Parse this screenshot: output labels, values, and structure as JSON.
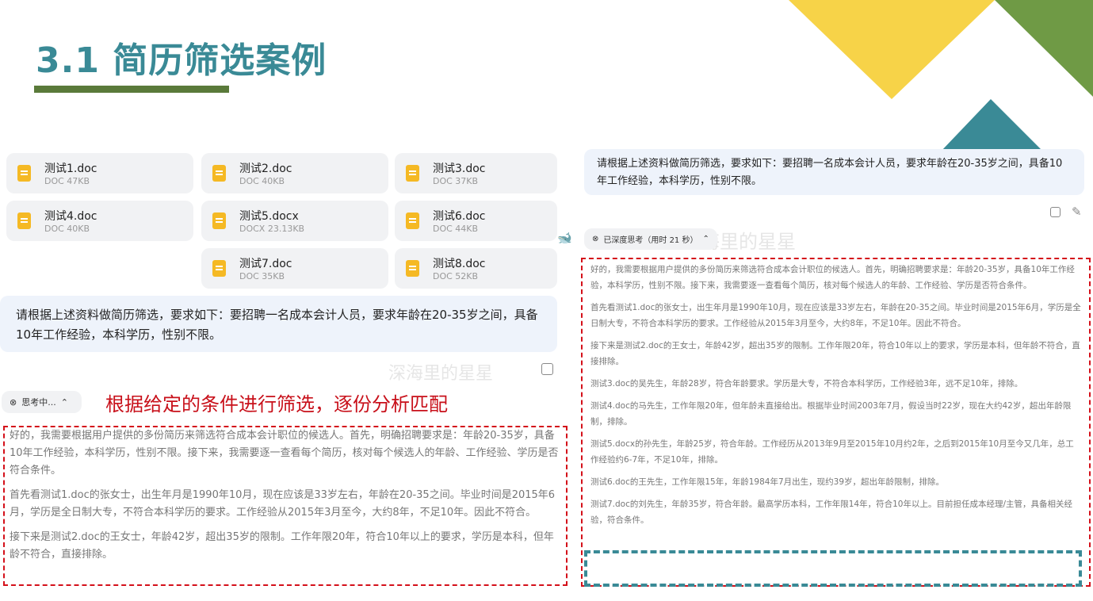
{
  "slide": {
    "title": "3.1 简历筛选案例",
    "annotation": "根据给定的条件进行筛选，逐份分析匹配",
    "colors": {
      "teal": "#3a8a96",
      "green": "#5a7a3a",
      "yellow": "#f7d348",
      "red": "#d4101a"
    }
  },
  "files": [
    {
      "name": "测试1.doc",
      "meta": "DOC 47KB"
    },
    {
      "name": "测试2.doc",
      "meta": "DOC 40KB"
    },
    {
      "name": "测试3.doc",
      "meta": "DOC 37KB"
    },
    {
      "name": "测试4.doc",
      "meta": "DOC 40KB"
    },
    {
      "name": "测试5.docx",
      "meta": "DOCX 23.13KB"
    },
    {
      "name": "测试6.doc",
      "meta": "DOC 44KB"
    },
    {
      "name": "测试7.doc",
      "meta": "DOC 35KB"
    },
    {
      "name": "测试8.doc",
      "meta": "DOC 52KB"
    }
  ],
  "prompt": "请根据上述资料做简历筛选，要求如下：要招聘一名成本会计人员，要求年龄在20-35岁之间，具备10年工作经验，本科学历，性别不限。",
  "watermark": "深海里的星星",
  "left": {
    "thinking_label": "思考中...",
    "paragraphs": [
      "好的，我需要根据用户提供的多份简历来筛选符合成本会计职位的候选人。首先，明确招聘要求是：年龄20-35岁，具备10年工作经验，本科学历，性别不限。接下来，我需要逐一查看每个简历，核对每个候选人的年龄、工作经验、学历是否符合条件。",
      "首先看测试1.doc的张女士，出生年月是1990年10月，现在应该是33岁左右，年龄在20-35之间。毕业时间是2015年6月，学历是全日制大专，不符合本科学历的要求。工作经验从2015年3月至今，大约8年，不足10年。因此不符合。",
      "接下来是测试2.doc的王女士，年龄42岁，超出35岁的限制。工作年限20年，符合10年以上的要求，学历是本科，但年龄不符合，直接排除。"
    ]
  },
  "right": {
    "thinking_label": "已深度思考（用时 21 秒）",
    "paragraphs": [
      "好的，我需要根据用户提供的多份简历来筛选符合成本会计职位的候选人。首先，明确招聘要求是：年龄20-35岁，具备10年工作经验，本科学历，性别不限。接下来，我需要逐一查看每个简历，核对每个候选人的年龄、工作经验、学历是否符合条件。",
      "首先看测试1.doc的张女士，出生年月是1990年10月，现在应该是33岁左右，年龄在20-35之间。毕业时间是2015年6月，学历是全日制大专，不符合本科学历的要求。工作经验从2015年3月至今，大约8年，不足10年。因此不符合。",
      "接下来是测试2.doc的王女士，年龄42岁，超出35岁的限制。工作年限20年，符合10年以上的要求，学历是本科，但年龄不符合，直接排除。",
      "测试3.doc的吴先生，年龄28岁，符合年龄要求。学历是大专，不符合本科学历，工作经验3年，远不足10年，排除。",
      "测试4.doc的马先生，工作年限20年，但年龄未直接给出。根据毕业时间2003年7月，假设当时22岁，现在大约42岁，超出年龄限制，排除。",
      "测试5.docx的孙先生，年龄25岁，符合年龄。工作经历从2013年9月至2015年10月约2年，之后到2015年10月至今又几年，总工作经验约6-7年，不足10年，排除。",
      "测试6.doc的王先生，工作年限15年，年龄1984年7月出生，现约39岁，超出年龄限制，排除。",
      "测试7.doc的刘先生，年龄35岁，符合年龄。最高学历本科，工作年限14年，符合10年以上。目前担任成本经理/主管，具备相关经验，符合条件。"
    ]
  }
}
